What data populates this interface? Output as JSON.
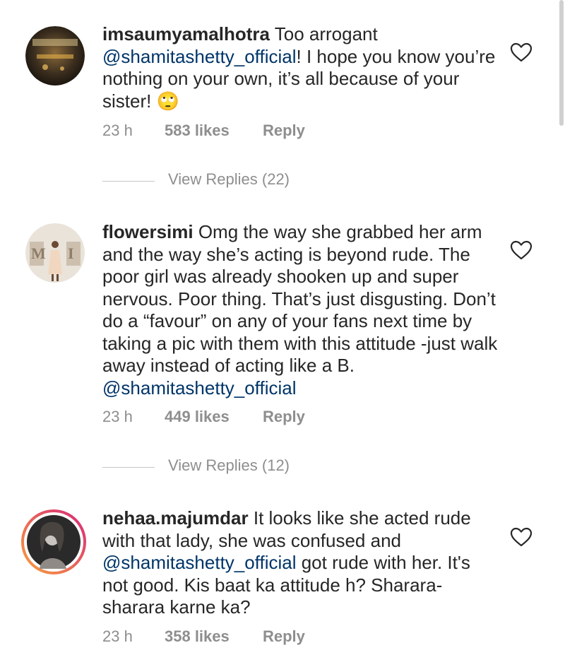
{
  "comments": [
    {
      "username": "imsaumyamalhotra",
      "text_before": " Too arrogant ",
      "mention": "@shamitashetty_official",
      "text_after": "! I hope you know you’re nothing on your own, it’s all because of your sister! 🙄",
      "time": "23 h",
      "likes": "583 likes",
      "reply_label": "Reply",
      "view_replies": "View Replies (22)"
    },
    {
      "username": "flowersimi",
      "text_before": " Omg the way she grabbed her arm and the way she’s acting is beyond rude. The poor girl was already shooken up and super nervous. Poor thing. That’s just disgusting. Don’t do a “favour” on any of your fans next time by taking a pic with them with this attitude -just walk away instead of acting like a B. ",
      "mention": "@shamitashetty_official",
      "text_after": "",
      "time": "23 h",
      "likes": "449 likes",
      "reply_label": "Reply",
      "view_replies": "View Replies (12)"
    },
    {
      "username": "nehaa.majumdar",
      "text_before": " It looks like she acted rude with that lady, she was confused and ",
      "mention": "@shamitashetty_official",
      "text_after": " got rude with her. It's not good. Kis baat ka attitude h? Sharara-sharara karne ka?",
      "time": "23 h",
      "likes": "358 likes",
      "reply_label": "Reply",
      "view_replies": ""
    }
  ],
  "colors": {
    "text": "#262626",
    "meta": "#8e8e8e",
    "mention": "#003569",
    "story_ring_start": "#f9a13b",
    "story_ring_end": "#d6267a"
  },
  "icons": {
    "like": "heart-outline-icon"
  }
}
